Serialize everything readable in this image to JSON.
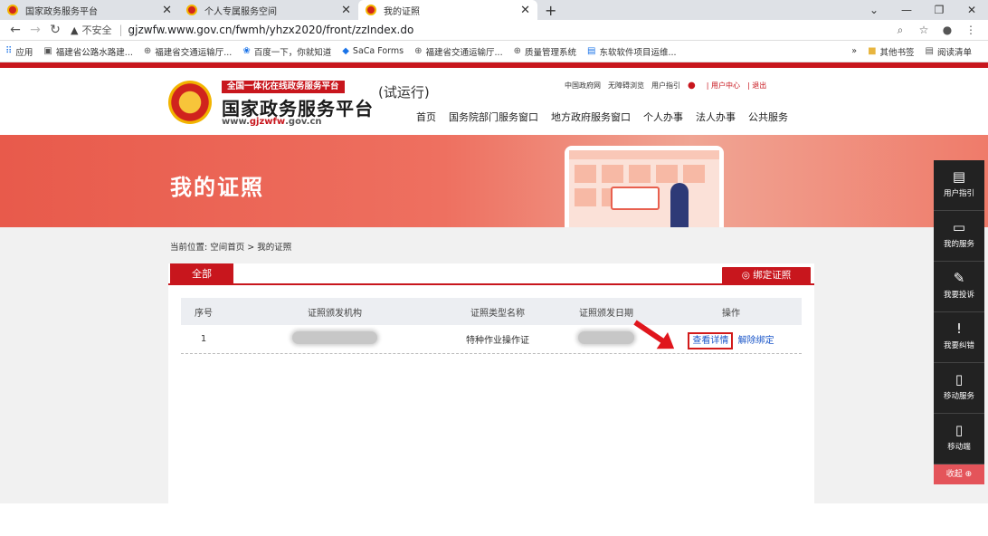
{
  "browser": {
    "tabs": [
      {
        "title": "国家政务服务平台",
        "active": false
      },
      {
        "title": "个人专属服务空间",
        "active": false
      },
      {
        "title": "我的证照",
        "active": true
      }
    ],
    "new_tab": "+",
    "window_controls": [
      "⌄",
      "—",
      "❐",
      "✕"
    ],
    "address": {
      "security": "不安全",
      "url": "gjzwfw.www.gov.cn/fwmh/yhzx2020/front/zzIndex.do"
    },
    "bookmarks": [
      {
        "label": "应用",
        "icon": "apps-grid-icon"
      },
      {
        "label": "福建省公路水路建...",
        "icon": "image-icon"
      },
      {
        "label": "福建省交通运输厅...",
        "icon": "globe-icon"
      },
      {
        "label": "百度一下，你就知道",
        "icon": "baidu-paw-icon"
      },
      {
        "label": "SaCa Forms",
        "icon": "saca-icon"
      },
      {
        "label": "福建省交通运输厅...",
        "icon": "globe-icon"
      },
      {
        "label": "质量管理系统",
        "icon": "globe-icon"
      },
      {
        "label": "东软软件项目运维...",
        "icon": "doc-icon"
      }
    ],
    "bookmarks_more": "»",
    "other_bookmarks": "其他书签",
    "reading_list": "阅读清单"
  },
  "site": {
    "brand_tag": "全国一体化在线政务服务平台",
    "brand_name": "国家政务服务平台",
    "brand_url_prefix": "www.",
    "brand_url_mid": "gjzwfw",
    "brand_url_suffix": ".gov.cn",
    "trial": "(试运行)",
    "top_links": [
      "中国政府网",
      "无障碍浏览",
      "用户指引"
    ],
    "user_center": "| 用户中心",
    "logout": "| 退出",
    "nav": [
      "首页",
      "国务院部门服务窗口",
      "地方政府服务窗口",
      "个人办事",
      "法人办事",
      "公共服务"
    ]
  },
  "banner": {
    "title": "我的证照"
  },
  "breadcrumb": "当前位置:  空间首页 >  我的证照",
  "panel": {
    "tab_all": "全部",
    "bind_button": "◎ 绑定证照",
    "columns": [
      "序号",
      "证照颁发机构",
      "证照类型名称",
      "证照颁发日期",
      "操作"
    ],
    "rows": [
      {
        "index": "1",
        "authority": "",
        "type": "特种作业操作证",
        "date": "",
        "view": "查看详情",
        "unbind": "解除绑定"
      }
    ]
  },
  "sidebar": {
    "items": [
      {
        "label": "用户指引",
        "icon": "guide-icon",
        "glyph": "▤"
      },
      {
        "label": "我的服务",
        "icon": "monitor-icon",
        "glyph": "▭"
      },
      {
        "label": "我要投诉",
        "icon": "complaint-icon",
        "glyph": "✎"
      },
      {
        "label": "我要纠错",
        "icon": "correction-icon",
        "glyph": "!"
      },
      {
        "label": "移动服务",
        "icon": "mobile-service-icon",
        "glyph": "▯"
      },
      {
        "label": "移动端",
        "icon": "phone-icon",
        "glyph": "▯"
      }
    ],
    "collapse": "收起 ⊕"
  },
  "colors": {
    "brand_red": "#c8161d",
    "link_blue": "#1a56c9",
    "sidebar_bg": "#222222"
  }
}
